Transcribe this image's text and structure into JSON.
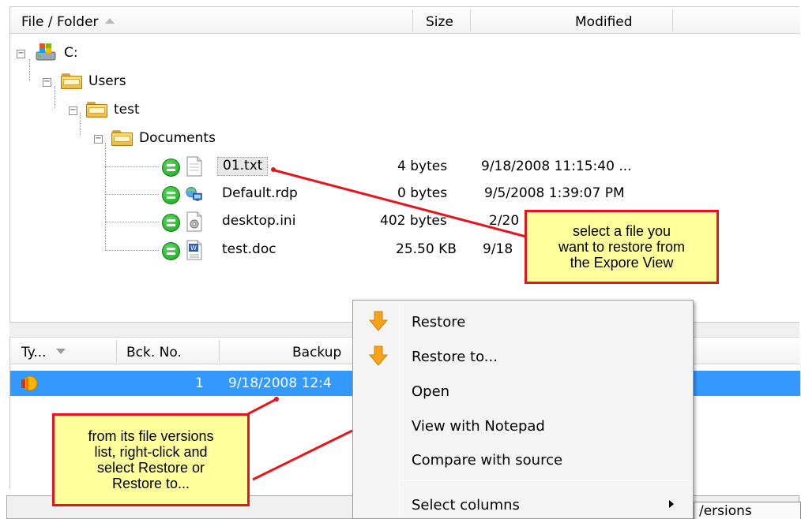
{
  "explorer": {
    "columns": {
      "name": "File / Folder",
      "size": "Size",
      "modified": "Modified"
    },
    "tree": {
      "drive": "C:",
      "users": "Users",
      "test": "test",
      "documents": "Documents"
    },
    "files": [
      {
        "name": "01.txt",
        "size": "4 bytes",
        "modified": "9/18/2008 11:15:40 ...",
        "icon": "text-file-icon"
      },
      {
        "name": "Default.rdp",
        "size": "0 bytes",
        "modified": "9/5/2008 1:39:07 PM",
        "icon": "remote-desktop-icon"
      },
      {
        "name": "desktop.ini",
        "size": "402 bytes",
        "modified": "2/20",
        "icon": "settings-file-icon"
      },
      {
        "name": "test.doc",
        "size": "25.50 KB",
        "modified": "9/18",
        "icon": "word-document-icon"
      }
    ]
  },
  "versions": {
    "columns": {
      "type": "Ty...",
      "backup_no": "Bck. No.",
      "backup": "Backup"
    },
    "rows": [
      {
        "backup_no": "1",
        "backup": "9/18/2008 12:4"
      }
    ],
    "status_tab": "/ersions"
  },
  "context_menu": {
    "items": [
      {
        "label": "Restore",
        "icon": "restore-arrow-icon"
      },
      {
        "label": "Restore to...",
        "icon": "restore-arrow-icon"
      },
      {
        "label": "Open"
      },
      {
        "label": "View with Notepad"
      },
      {
        "label": "Compare with source"
      },
      {
        "label": "Select columns",
        "submenu": true
      }
    ]
  },
  "callouts": {
    "top": "select a file you\nwant to restore from\nthe Expore View",
    "bottom": "from its file versions\nlist, right-click and\nselect Restore or\nRestore to..."
  },
  "colors": {
    "selection": "#3399ff",
    "callout_fill": "#ffff9c",
    "callout_border": "#e8141c",
    "status_ok": "#17a21c"
  }
}
